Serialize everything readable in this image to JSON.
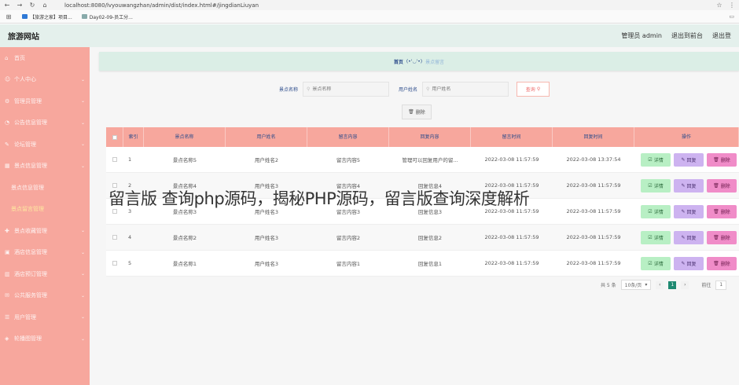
{
  "browser": {
    "url": "localhost:8080/lvyouwangzhan/admin/dist/index.html#/jingdianLiuyan",
    "bookmarks": [
      "【旅游之家】项目...",
      "Day02-09-员工分..."
    ]
  },
  "header": {
    "title": "旅游网站",
    "user": "管理员 admin",
    "back_to_front": "退出到前台",
    "logout": "退出登"
  },
  "sidebar": {
    "items": [
      {
        "label": "首页",
        "icon": "home-icon"
      },
      {
        "label": "个人中心",
        "icon": "user-icon"
      },
      {
        "label": "管理员管理",
        "icon": "admin-icon"
      },
      {
        "label": "公告信息管理",
        "icon": "notice-icon"
      },
      {
        "label": "论坛管理",
        "icon": "forum-icon"
      },
      {
        "label": "景点信息管理",
        "icon": "scenic-icon"
      },
      {
        "label": "景点信息管理",
        "icon": "",
        "sub": true
      },
      {
        "label": "景点留言管理",
        "icon": "",
        "sub": true,
        "active": true
      },
      {
        "label": "景点收藏管理",
        "icon": "collect-icon"
      },
      {
        "label": "酒店信息管理",
        "icon": "hotel-icon"
      },
      {
        "label": "酒店预订管理",
        "icon": "chart-icon"
      },
      {
        "label": "公共服务管理",
        "icon": "service-icon"
      },
      {
        "label": "用户管理",
        "icon": "users-icon"
      },
      {
        "label": "轮播图管理",
        "icon": "carousel-icon"
      }
    ]
  },
  "breadcrumb": {
    "home": "首页",
    "separator": "(•'◡'•)",
    "current": "景点留言"
  },
  "search": {
    "scenic_label": "景点名称",
    "scenic_placeholder": "景点名称",
    "user_label": "用户姓名",
    "user_placeholder": "用户姓名",
    "query_button": "查询"
  },
  "delete_button": "删除",
  "table": {
    "headers": [
      "索引",
      "景点名称",
      "用户姓名",
      "留言内容",
      "回复内容",
      "留言时间",
      "回复时间",
      "操作"
    ],
    "rows": [
      {
        "idx": "1",
        "name": "景点名称5",
        "user": "用户姓名2",
        "msg": "留言内容5",
        "reply": "管理可以回复用户的留...",
        "mtime": "2022-03-08 11:57:59",
        "rtime": "2022-03-08 13:37:54"
      },
      {
        "idx": "2",
        "name": "景点名称4",
        "user": "用户姓名3",
        "msg": "留言内容4",
        "reply": "回复信息4",
        "mtime": "2022-03-08 11:57:59",
        "rtime": "2022-03-08 11:57:59"
      },
      {
        "idx": "3",
        "name": "景点名称3",
        "user": "用户姓名3",
        "msg": "留言内容3",
        "reply": "回复信息3",
        "mtime": "2022-03-08 11:57:59",
        "rtime": "2022-03-08 11:57:59"
      },
      {
        "idx": "4",
        "name": "景点名称2",
        "user": "用户姓名3",
        "msg": "留言内容2",
        "reply": "回复信息2",
        "mtime": "2022-03-08 11:57:59",
        "rtime": "2022-03-08 11:57:59"
      },
      {
        "idx": "5",
        "name": "景点名称1",
        "user": "用户姓名3",
        "msg": "留言内容1",
        "reply": "回复信息1",
        "mtime": "2022-03-08 11:57:59",
        "rtime": "2022-03-08 11:57:59"
      }
    ],
    "op_labels": {
      "detail": "详情",
      "reply": "回复",
      "delete": "删除"
    }
  },
  "pagination": {
    "total": "共 5 条",
    "page_size": "10条/页",
    "current_page": "1",
    "goto_label": "前往",
    "goto_value": "1"
  },
  "watermark": "留言版 查询php源码，揭秘PHP源码，留言版查询深度解析"
}
